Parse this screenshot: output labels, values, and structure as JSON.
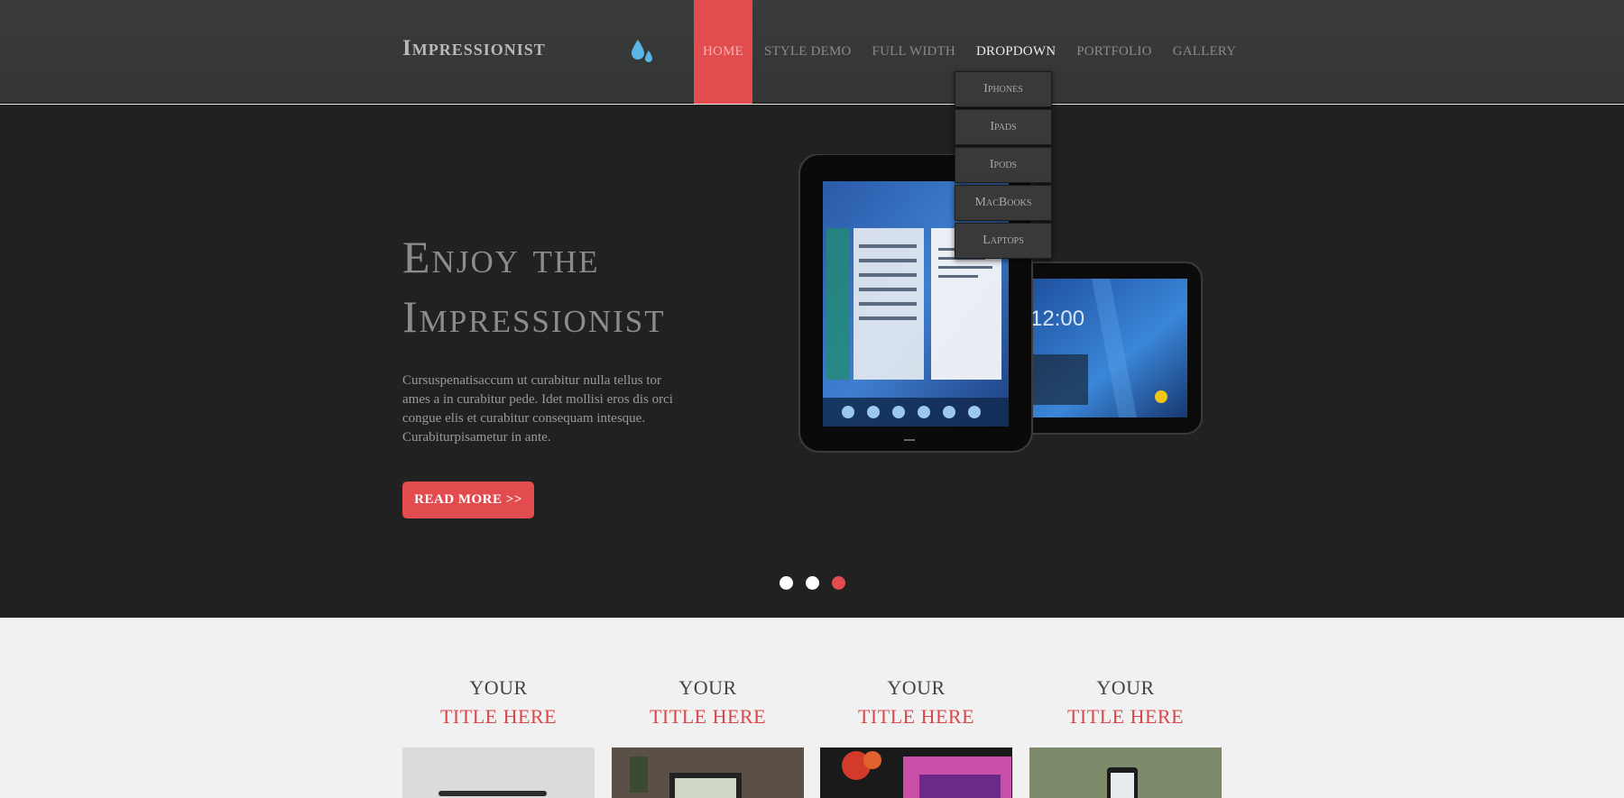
{
  "site": {
    "logo": "Impressionist"
  },
  "nav": {
    "items": [
      {
        "label": "Home"
      },
      {
        "label": "Style Demo"
      },
      {
        "label": "Full Width"
      },
      {
        "label": "Dropdown"
      },
      {
        "label": "Portfolio"
      },
      {
        "label": "Gallery"
      }
    ],
    "dropdown": [
      "Iphones",
      "Ipads",
      "Ipods",
      "MacBooks",
      "Laptops"
    ]
  },
  "hero": {
    "title_line1": "Enjoy the",
    "title_line2": "Impressionist",
    "text": "Cursuspenatisaccum ut curabitur nulla tellus tor ames a in curabitur pede. Idet mollisi eros dis orci congue elis et curabitur consequam intesque. Curabiturpisametur in ante.",
    "button": "READ MORE >>",
    "device_clock": "12:00",
    "active_slide": 3,
    "slides": 3
  },
  "features": [
    {
      "line1": "Your",
      "line2": "Title here"
    },
    {
      "line1": "Your",
      "line2": "Title here"
    },
    {
      "line1": "Your",
      "line2": "Title here"
    },
    {
      "line1": "Your",
      "line2": "Title here"
    }
  ],
  "colors": {
    "accent": "#e24c4f",
    "header": "#373838",
    "hero": "#212121",
    "body": "#f1f1f1"
  }
}
